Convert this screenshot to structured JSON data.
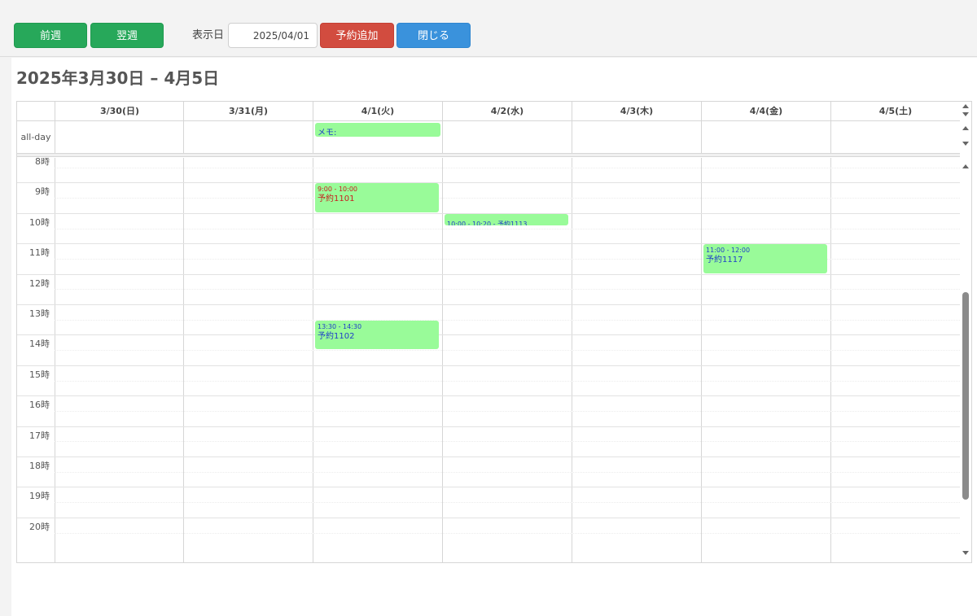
{
  "toolbar": {
    "prev_week": "前週",
    "next_week": "翌週",
    "display_date_label": "表示日",
    "display_date_value": "2025/04/01",
    "add_reservation": "予約追加",
    "close": "閉じる"
  },
  "colors": {
    "green_button": "#27a85a",
    "red_button": "#d24c3f",
    "blue_button": "#3a92dc",
    "event_bg": "#99fb99",
    "event_text_red": "#c81e1e",
    "event_text_blue": "#1f3fc8"
  },
  "calendar": {
    "title": "2025年3月30日 – 4月5日",
    "days": [
      "3/30(日)",
      "3/31(月)",
      "4/1(火)",
      "4/2(水)",
      "4/3(木)",
      "4/4(金)",
      "4/5(土)"
    ],
    "allday_label": "all-day",
    "allday_events": [
      {
        "day": 2,
        "text": "メモ:"
      }
    ],
    "hours": [
      "8時",
      "9時",
      "10時",
      "11時",
      "12時",
      "13時",
      "14時",
      "15時",
      "16時",
      "17時",
      "18時",
      "19時",
      "20時"
    ],
    "events": [
      {
        "day": 2,
        "start": "9:00",
        "end": "10:00",
        "time": "9:00 - 10:00",
        "name": "予約1101",
        "color": "red",
        "inline": false
      },
      {
        "day": 3,
        "start": "10:00",
        "end": "10:20",
        "time": "10:00 - 10:20 - ",
        "name": "予約1113",
        "color": "blue",
        "inline": true
      },
      {
        "day": 5,
        "start": "11:00",
        "end": "12:00",
        "time": "11:00 - 12:00",
        "name": "予約1117",
        "color": "blue",
        "inline": false
      },
      {
        "day": 2,
        "start": "13:30",
        "end": "14:30",
        "time": "13:30 - 14:30",
        "name": "予約1102",
        "color": "blue",
        "inline": false
      }
    ]
  }
}
